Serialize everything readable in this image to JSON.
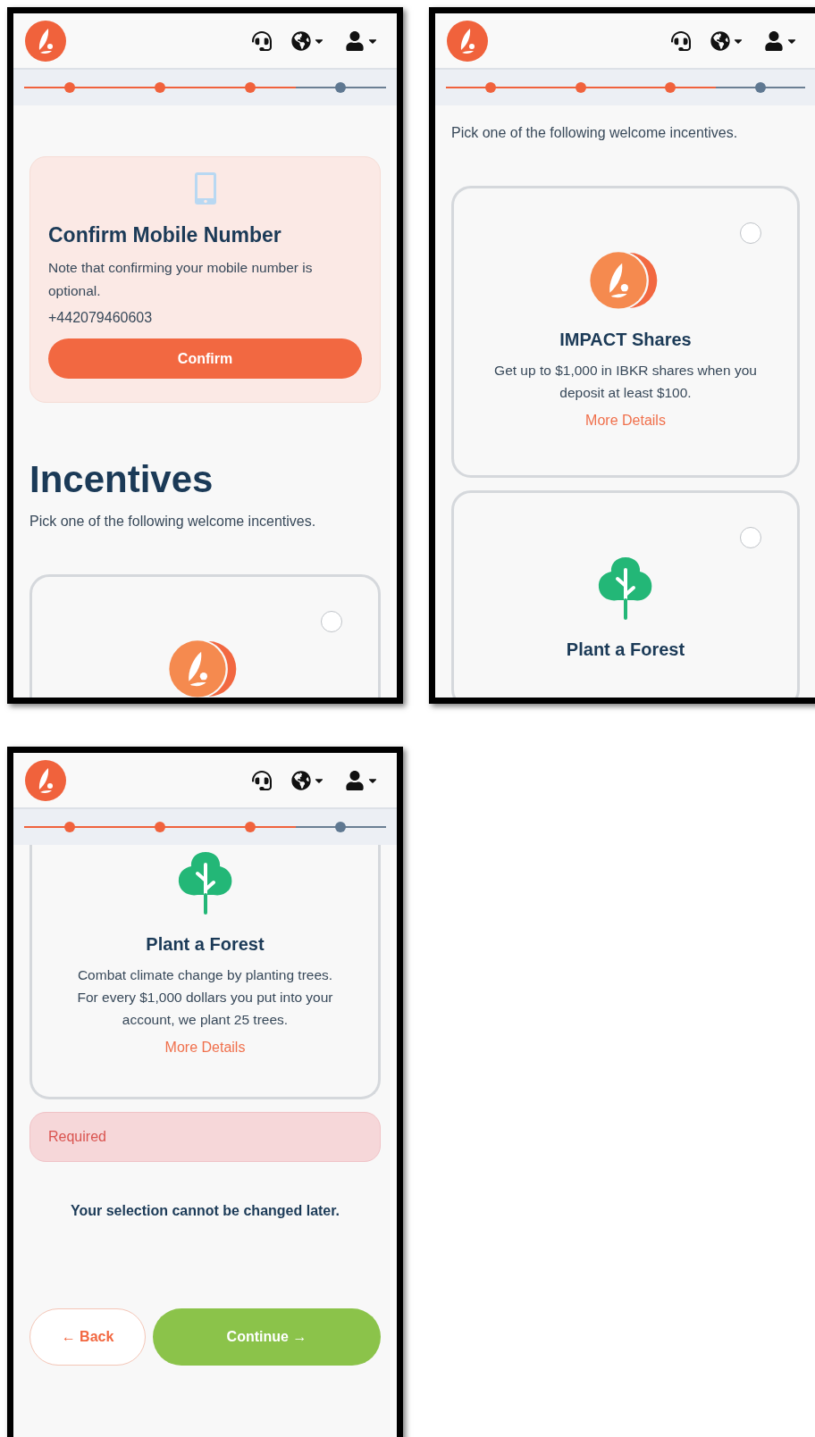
{
  "screens": [
    {
      "progress": [
        {
          "done": true
        },
        {
          "done": true
        },
        {
          "done": true
        },
        {
          "done": false
        }
      ],
      "blocks": [
        {
          "kind": "confirm_card",
          "title": "Confirm Mobile Number",
          "note": "Note that confirming your mobile number is optional.",
          "phone": "+442079460603",
          "button": "Confirm"
        },
        {
          "kind": "heading",
          "text": "Incentives"
        },
        {
          "kind": "text",
          "text": "Pick one of the following welcome incentives."
        },
        {
          "kind": "shares",
          "selected": false,
          "top_cut": false
        }
      ]
    },
    {
      "progress": [
        {
          "done": true
        },
        {
          "done": true
        },
        {
          "done": true
        },
        {
          "done": false
        }
      ],
      "blocks": [
        {
          "kind": "text",
          "text": "Pick one of the following welcome incentives."
        },
        {
          "kind": "shares",
          "selected": false,
          "top_cut": false,
          "title": "IMPACT Shares",
          "description": "Get up to $1,000 in IBKR shares when you deposit at least $100.",
          "link": "More Details"
        },
        {
          "kind": "forest",
          "selected": false,
          "top_cut": false,
          "title": "Plant a Forest"
        }
      ]
    },
    {
      "progress": [
        {
          "done": true
        },
        {
          "done": true
        },
        {
          "done": true
        },
        {
          "done": false
        }
      ],
      "blocks": [
        {
          "kind": "forest",
          "top_cut": true,
          "title": "Plant a Forest",
          "description": "Combat climate change by planting trees. For every $1,000 dollars you put into your account, we plant 25 trees.",
          "link": "More Details"
        },
        {
          "kind": "alert",
          "text": "Required"
        },
        {
          "kind": "note",
          "text": "Your selection cannot be changed later."
        },
        {
          "kind": "actions",
          "back": "← Back",
          "continue": "Continue →"
        }
      ]
    }
  ]
}
